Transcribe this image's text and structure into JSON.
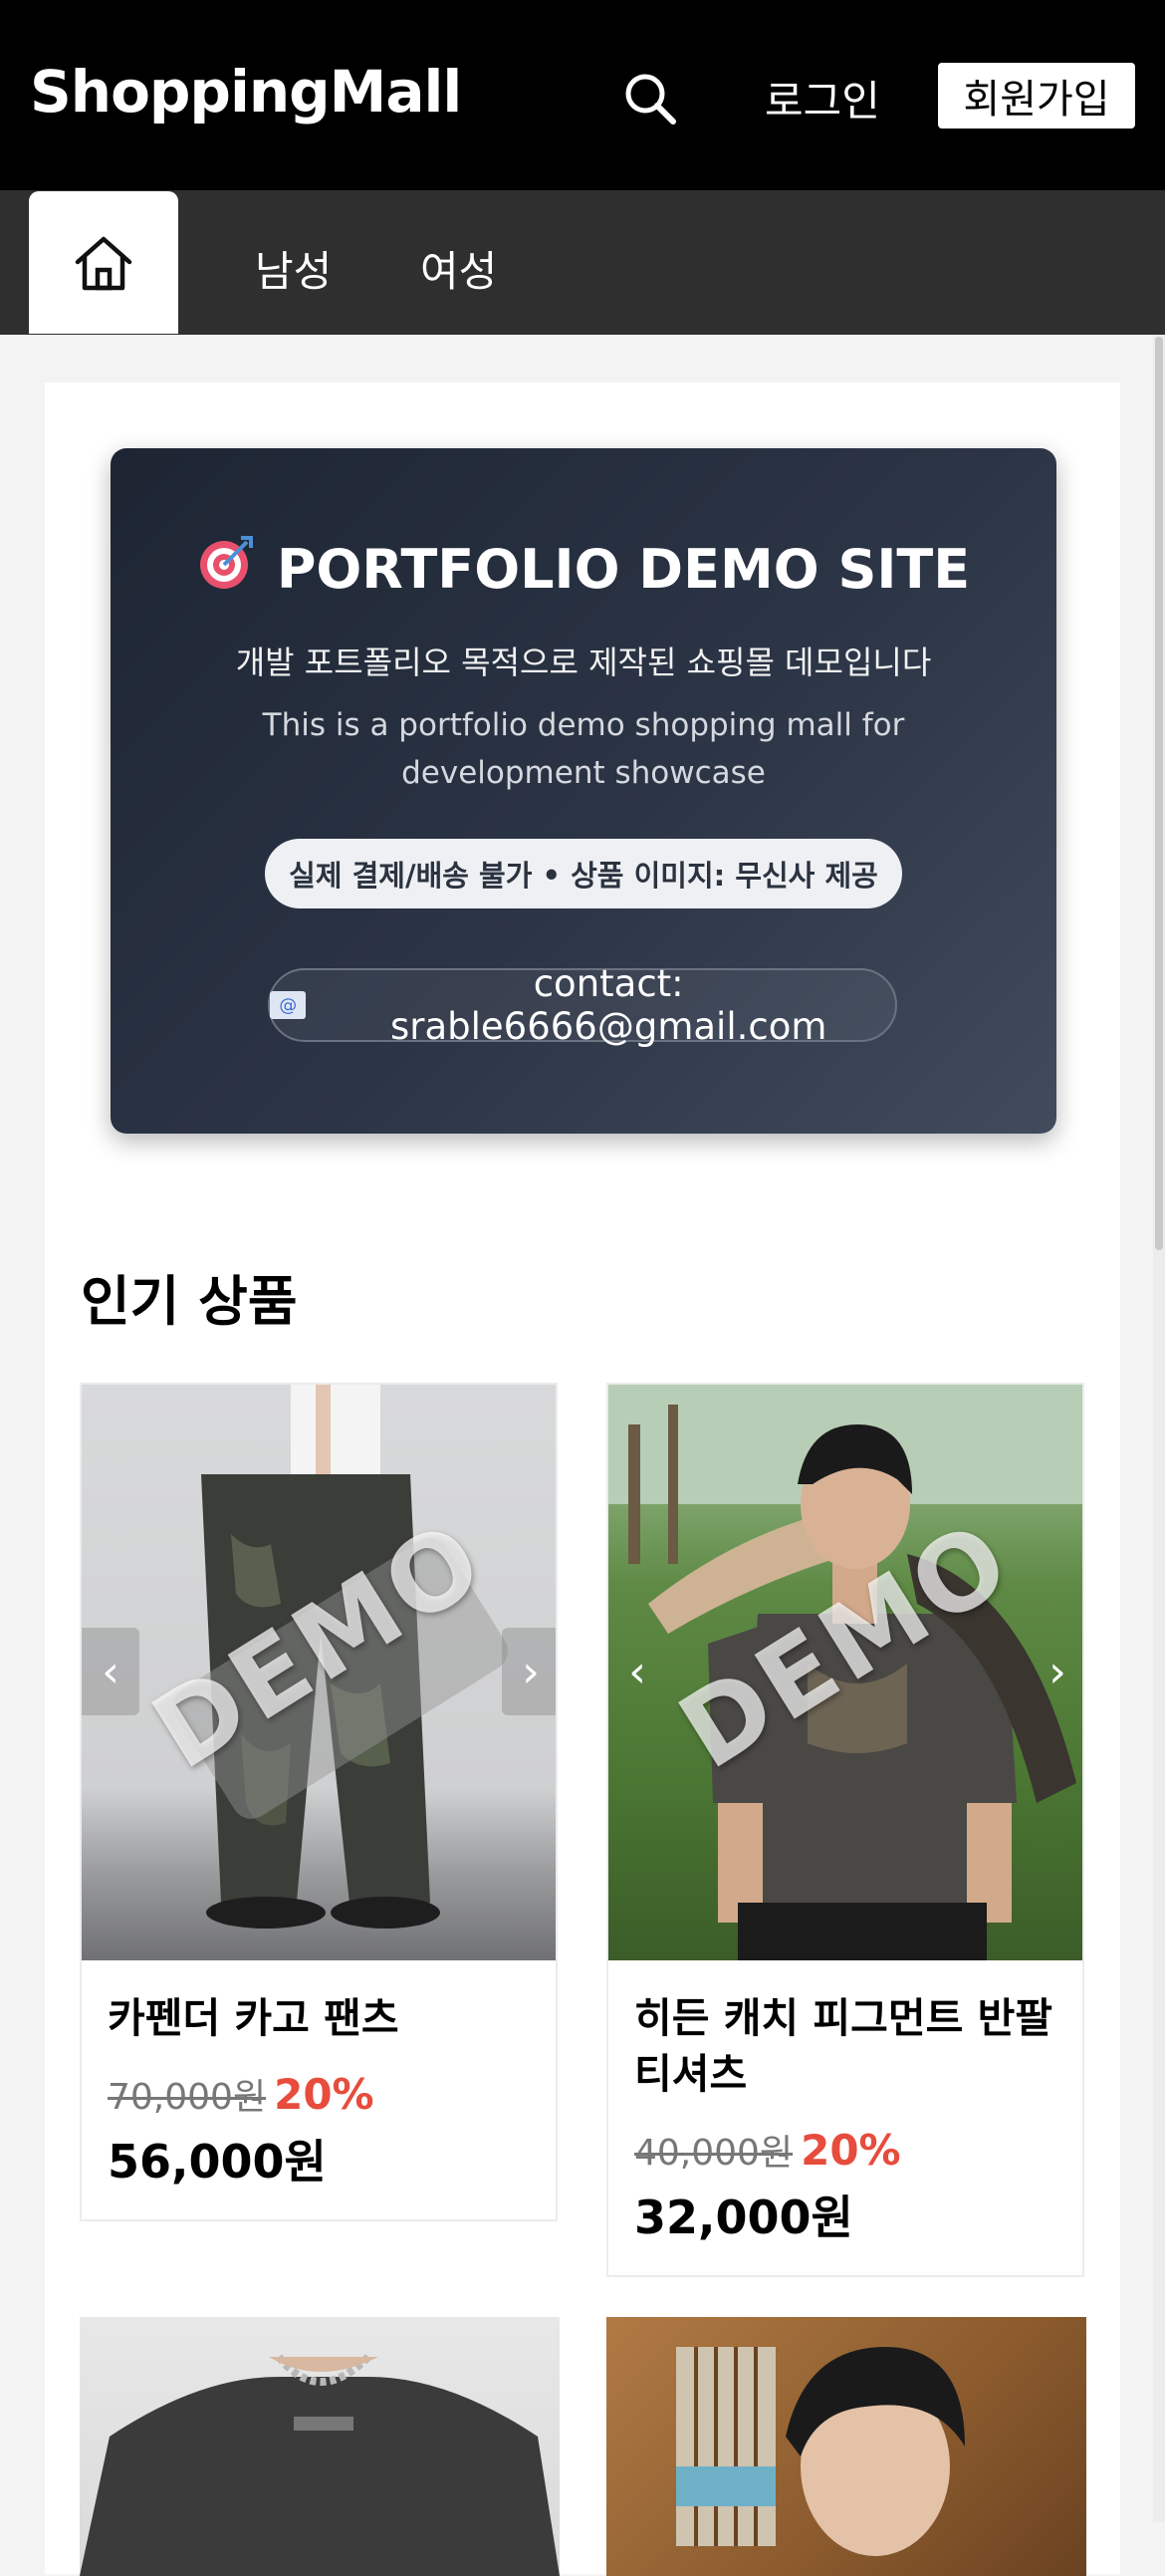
{
  "header": {
    "logo": "ShoppingMall",
    "login_label": "로그인",
    "signup_label": "회원가입"
  },
  "nav": {
    "tabs": [
      {
        "label": "남성"
      },
      {
        "label": "여성"
      }
    ]
  },
  "banner": {
    "emoji": "🎯",
    "title": "PORTFOLIO DEMO SITE",
    "subtitle_ko": "개발 포트폴리오 목적으로 제작된 쇼핑몰 데모입니다",
    "subtitle_en": "This is a portfolio demo shopping mall for development showcase",
    "notice": "실제 결제/배송 불가 • 상품 이미지: 무신사 제공",
    "contact": "contact: srable6666@gmail.com"
  },
  "section_title": "인기 상품",
  "products": [
    {
      "demo_label": "DEMO",
      "name": "카펜더 카고 팬츠",
      "original_price": "70,000원",
      "discount": "20%",
      "final_price": "56,000원"
    },
    {
      "demo_label": "DEMO",
      "name": "히든 캐치 피그먼트 반팔 티셔츠",
      "original_price": "40,000원",
      "discount": "20%",
      "final_price": "32,000원"
    }
  ],
  "colors": {
    "discount": "#e74c3c",
    "header_bg": "#000000",
    "nav_bg": "#2f2f2f"
  }
}
